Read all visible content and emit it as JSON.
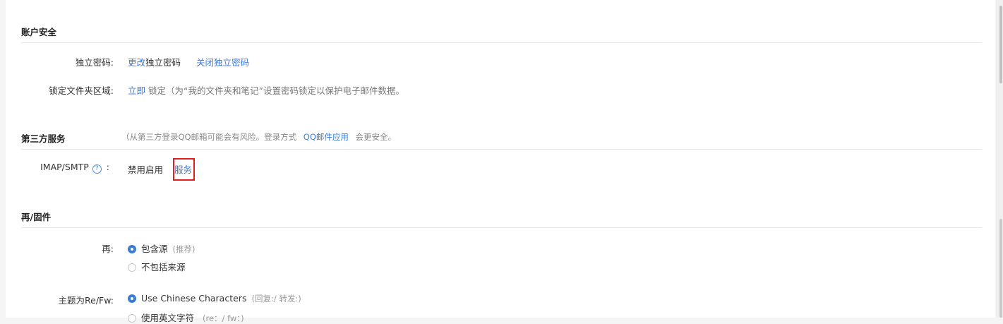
{
  "account_security": {
    "title": "账户安全",
    "independent_password": {
      "label": "独立密码:",
      "change_link": "更改",
      "change_suffix": "独立密码",
      "close_link": "关闭独立密码"
    },
    "lock_folder": {
      "label": "锁定文件夹区域:",
      "immediate_link": "立即",
      "description": "锁定（为“我的文件夹和笔记”设置密码锁定以保护电子邮件数据。"
    }
  },
  "third_party": {
    "title": "第三方服务",
    "note_prefix": "（从第三方登录QQ邮箱可能会有风险。登录方式",
    "note_link": "QQ邮件应用",
    "note_suffix": "会更安全。",
    "imap": {
      "label": "IMAP/SMTP",
      "help_icon": "?",
      "colon": ":",
      "status_text": "禁用启用",
      "service_link": "服务"
    }
  },
  "re_attachment": {
    "title": "再/固件",
    "re": {
      "label": "再:",
      "options": [
        {
          "label": "包含源",
          "hint": "(推荐)",
          "checked": true
        },
        {
          "label": "不包括来源",
          "hint": "",
          "checked": false
        }
      ]
    },
    "subject": {
      "label": "主题为Re/Fw:",
      "options": [
        {
          "label": "Use Chinese Characters",
          "hint": "(回复:/ 转发:)",
          "checked": true
        },
        {
          "label": "使用英文字符",
          "hint": "(re：/ fw：)",
          "checked": false
        }
      ]
    }
  },
  "colors": {
    "link": "#3a7bd5",
    "highlight": "#e02020"
  }
}
